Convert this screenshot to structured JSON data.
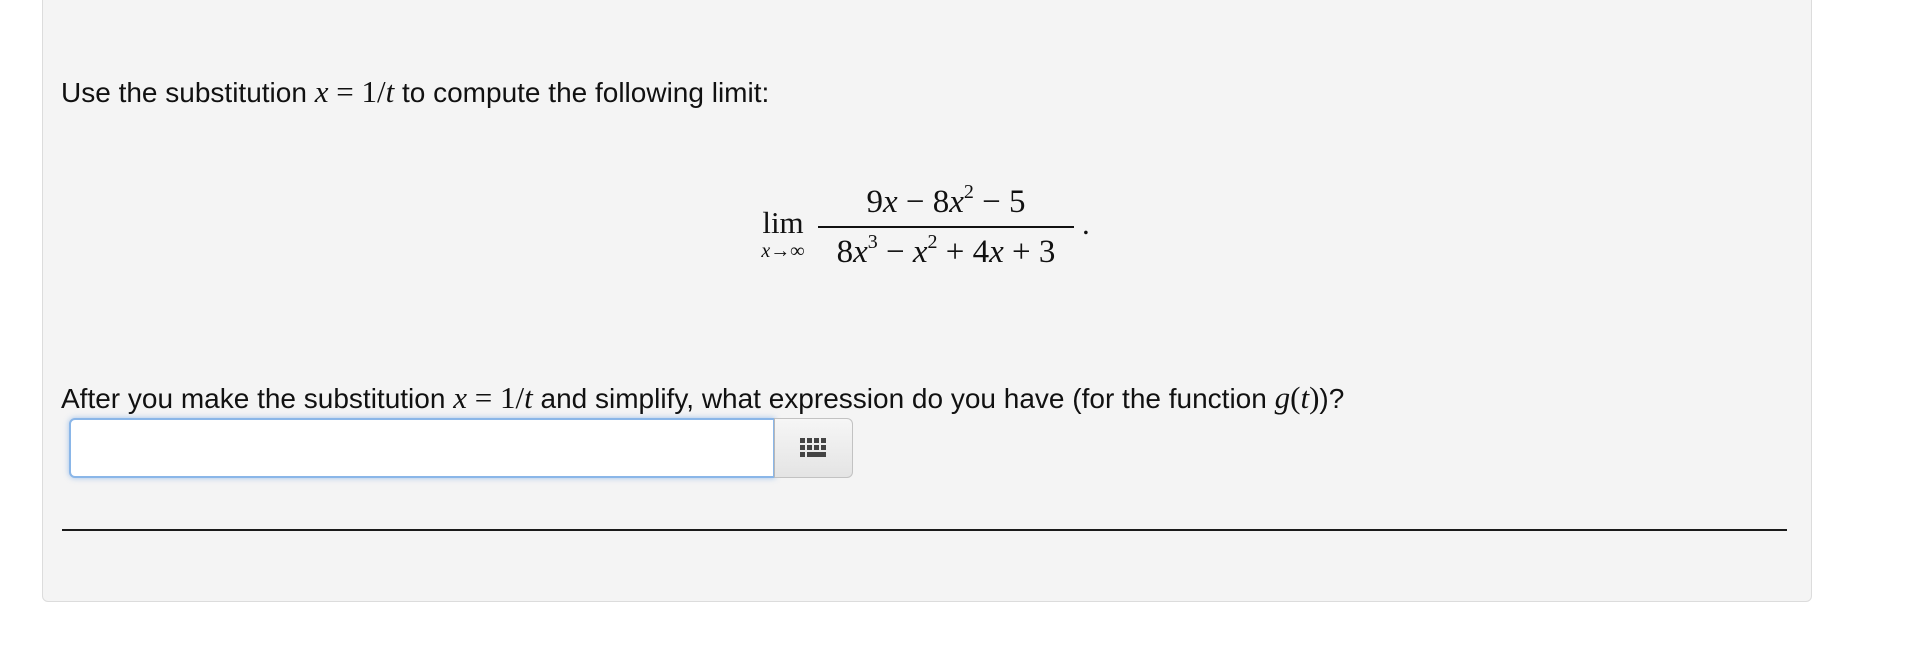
{
  "question": {
    "intro_before": "Use the substitution ",
    "intro_var": "x",
    "intro_eq": " = ",
    "intro_val_num": "1/",
    "intro_val_t": "t",
    "intro_after": " to compute the following limit:"
  },
  "limit": {
    "lim": "lim",
    "sub": "x→∞",
    "numerator": {
      "t1": "9",
      "v1": "x",
      "op1": " − 8",
      "v2": "x",
      "e2": "2",
      "op2": " − 5"
    },
    "denominator": {
      "t1": "8",
      "v1": "x",
      "e1": "3",
      "op1": " − ",
      "v2": "x",
      "e2": "2",
      "op2": " + 4",
      "v3": "x",
      "op3": " + 3"
    },
    "trailing": "."
  },
  "prompt": {
    "before": "After you make the substitution ",
    "var": "x",
    "eq": " = ",
    "val_num": "1/",
    "val_t": "t",
    "middle": " and simplify, what expression do you have (for the function ",
    "fn": "g",
    "paren_open": "(",
    "arg": "t",
    "paren_close": ")",
    "after": ")?"
  },
  "answer": {
    "value": "",
    "placeholder": ""
  },
  "palette_button": {
    "icon": "grid-icon"
  }
}
